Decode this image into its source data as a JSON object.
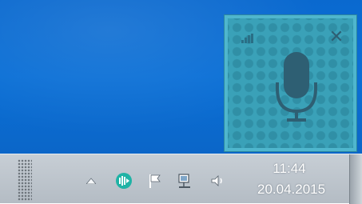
{
  "widget": {
    "close_icon": "close-icon",
    "microphone_icon": "microphone-icon",
    "signal_icon": "signal-strength-icon",
    "colors": {
      "background": "#3aa1b8",
      "border": "#4fb6cd",
      "icons": "#2e5f73"
    }
  },
  "taskbar": {
    "tray_icons": [
      "show-hidden-icons-arrow",
      "app-tray-icon",
      "action-center-flag-icon",
      "network-icon",
      "volume-icon"
    ],
    "clock": {
      "time": "11:44",
      "date": "20.04.2015"
    }
  }
}
